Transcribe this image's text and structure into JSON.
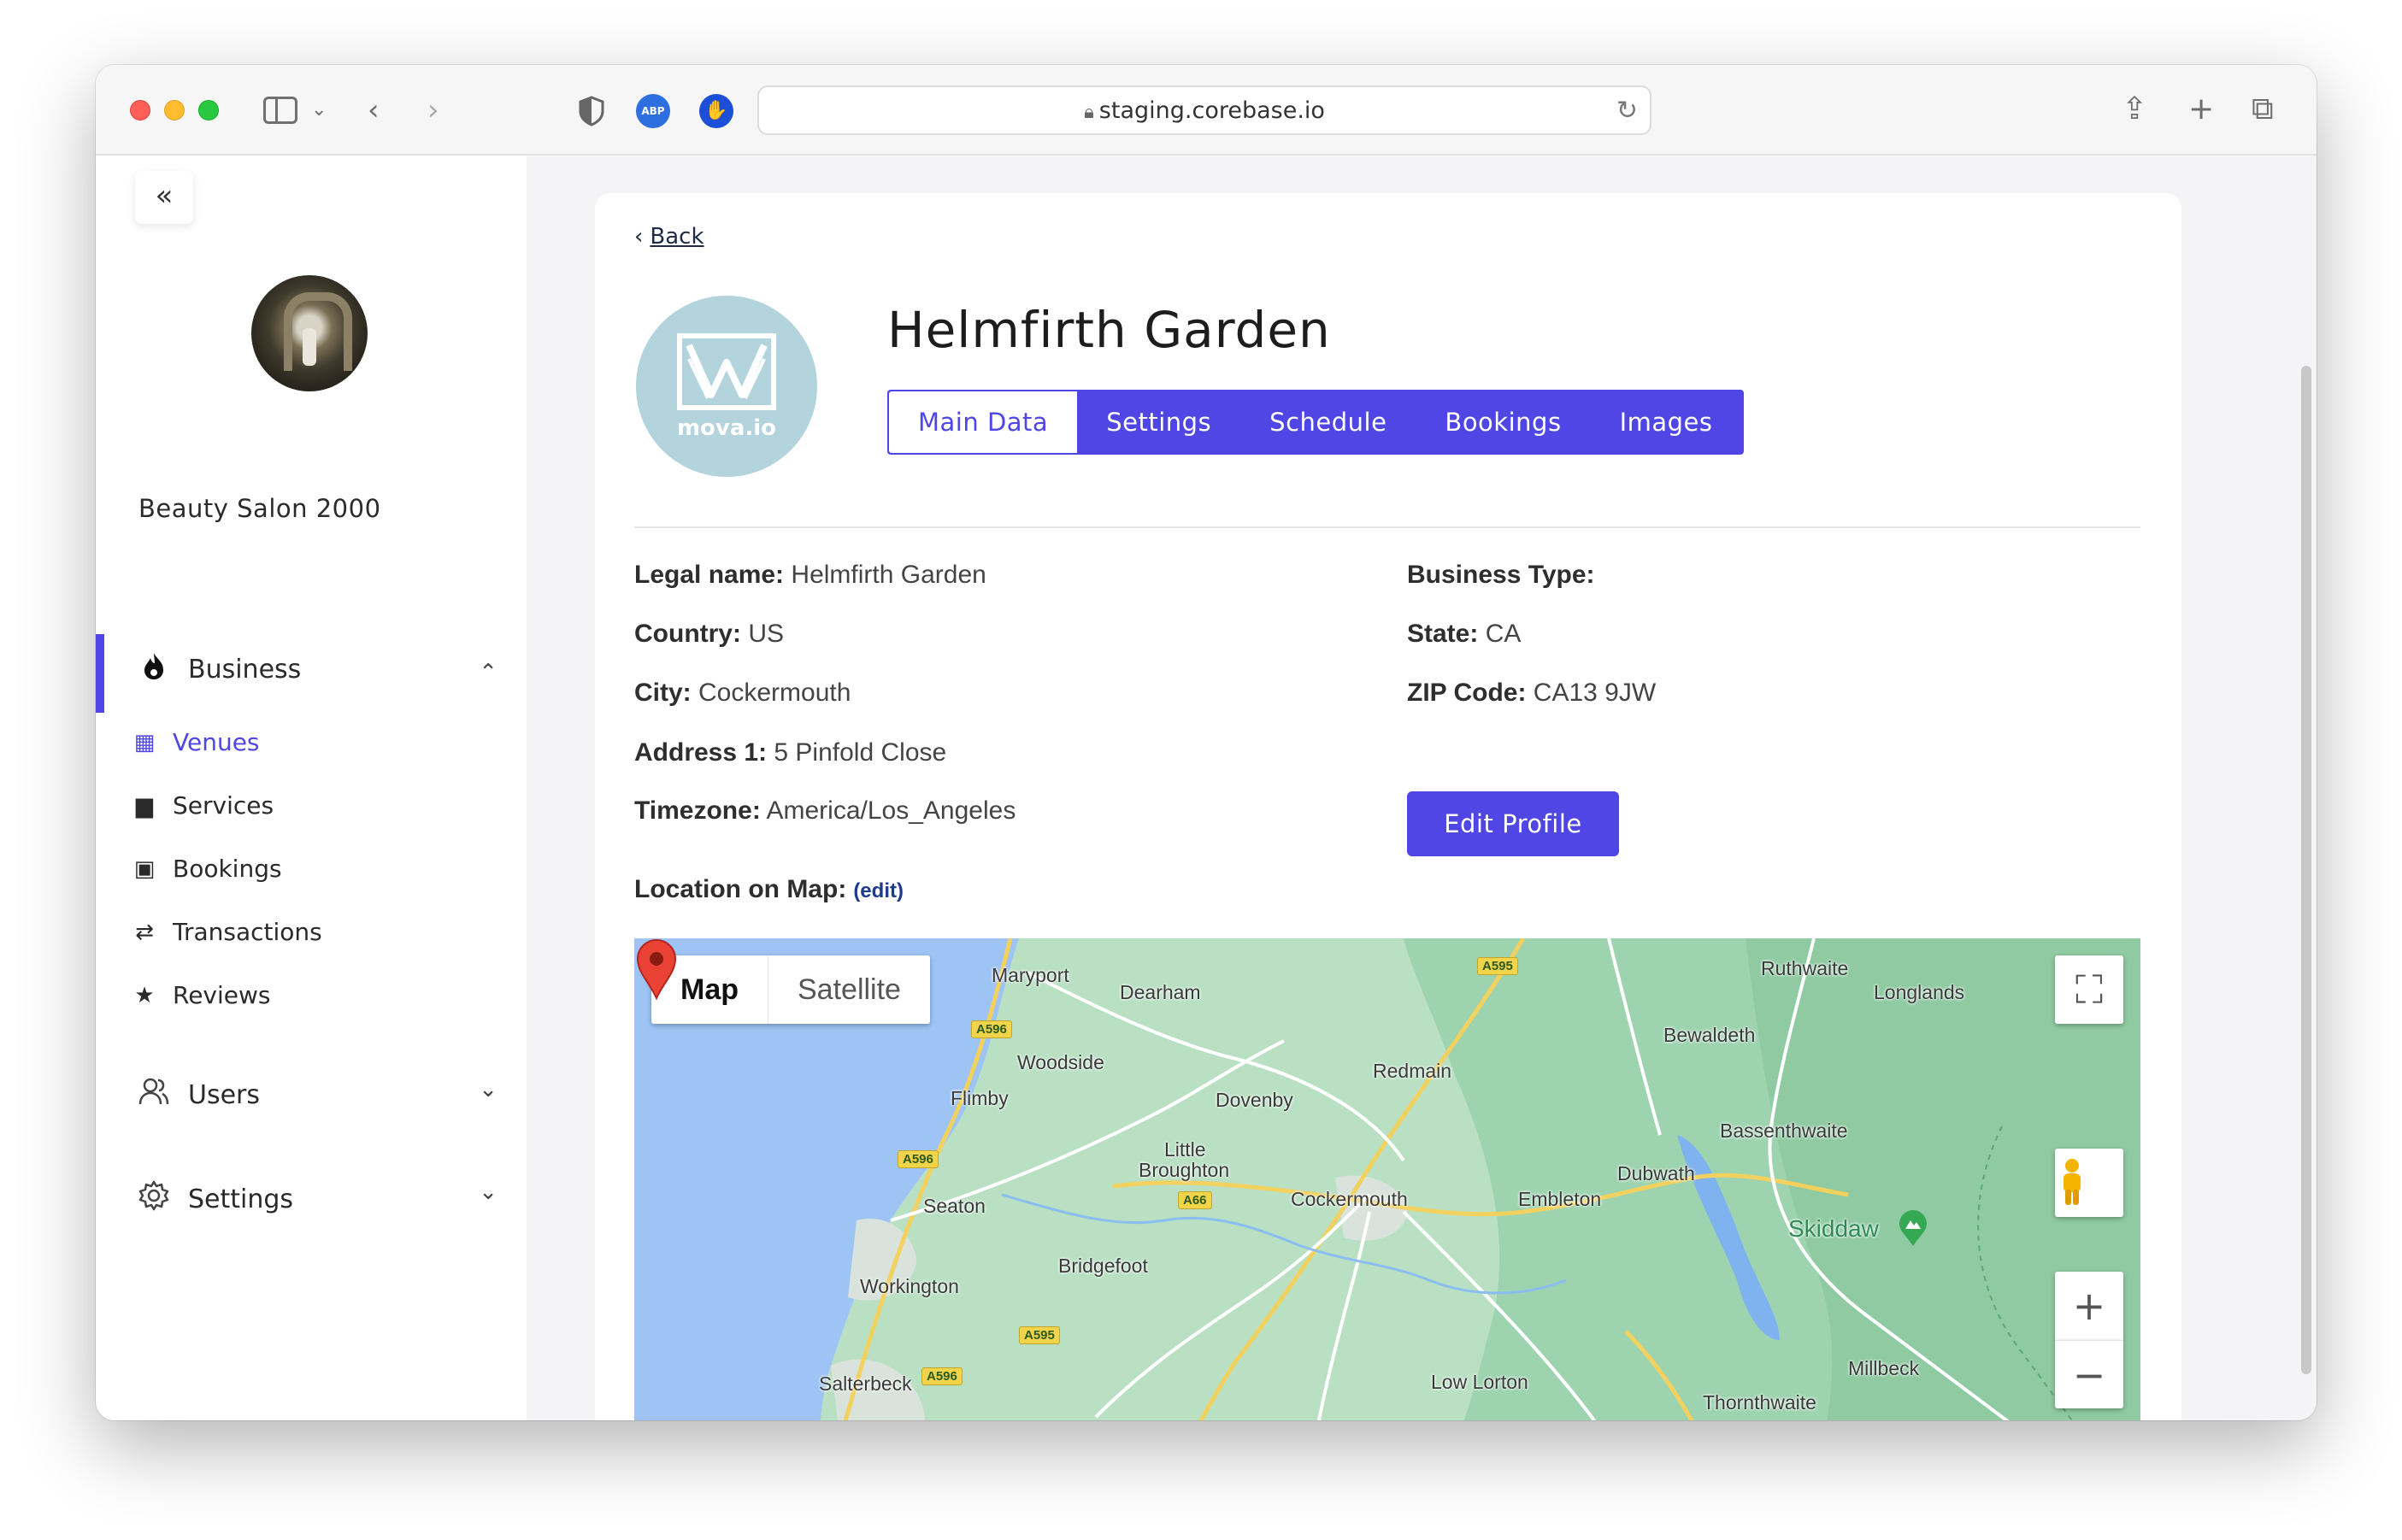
{
  "browser": {
    "url": "staging.corebase.io",
    "extensions": [
      "shield-icon",
      "adblock-icon",
      "hand-icon"
    ],
    "abp_label": "ABP"
  },
  "sidebar": {
    "collapse_icon": "«",
    "org_name": "Beauty Salon 2000",
    "business": {
      "label": "Business",
      "chevron": "⌃"
    },
    "business_items": [
      {
        "label": "Venues",
        "icon": "building-icon",
        "glyph": "▦"
      },
      {
        "label": "Services",
        "icon": "briefcase-icon",
        "glyph": "▆"
      },
      {
        "label": "Bookings",
        "icon": "contact-book-icon",
        "glyph": "▣"
      },
      {
        "label": "Transactions",
        "icon": "arrows-exchange-icon",
        "glyph": "⇄"
      },
      {
        "label": "Reviews",
        "icon": "star-icon",
        "glyph": "★"
      }
    ],
    "users": {
      "label": "Users",
      "chevron": "⌄"
    },
    "settings": {
      "label": "Settings",
      "chevron": "⌄"
    }
  },
  "venue": {
    "back_label": "Back",
    "logo_text": "mova.io",
    "title": "Helmfirth Garden",
    "tabs": [
      "Main Data",
      "Settings",
      "Schedule",
      "Bookings",
      "Images"
    ],
    "active_tab": "Main Data",
    "fields_left": [
      {
        "label": "Legal name:",
        "value": "Helmfirth Garden"
      },
      {
        "label": "Country:",
        "value": "US"
      },
      {
        "label": "City:",
        "value": "Cockermouth"
      },
      {
        "label": "Address 1:",
        "value": "5 Pinfold Close"
      },
      {
        "label": "Timezone:",
        "value": "America/Los_Angeles"
      }
    ],
    "fields_right": [
      {
        "label": "Business Type:",
        "value": ""
      },
      {
        "label": "State:",
        "value": "CA"
      },
      {
        "label": "ZIP Code:",
        "value": "CA13 9JW"
      }
    ],
    "edit_button": "Edit Profile",
    "location_label": "Location on Map:",
    "location_edit": "(edit)"
  },
  "map": {
    "type_options": [
      "Map",
      "Satellite"
    ],
    "selected_type": "Map",
    "places": [
      "Maryport",
      "Dearham",
      "Woodside",
      "Flimby",
      "Dovenby",
      "Redmain",
      "Little",
      "Broughton",
      "Seaton",
      "Cockermouth",
      "Embleton",
      "Dubwath",
      "Bassenthwaite",
      "Bewaldeth",
      "Ruthwaite",
      "Longlands",
      "Workington",
      "Bridgefoot",
      "Salterbeck",
      "Low Lorton",
      "Thornthwaite",
      "Millbeck",
      "Skiddaw"
    ],
    "roads": [
      "A595",
      "A596",
      "A596",
      "A66",
      "A595",
      "A596"
    ],
    "controls": {
      "zoom_in": "+",
      "zoom_out": "−"
    }
  }
}
